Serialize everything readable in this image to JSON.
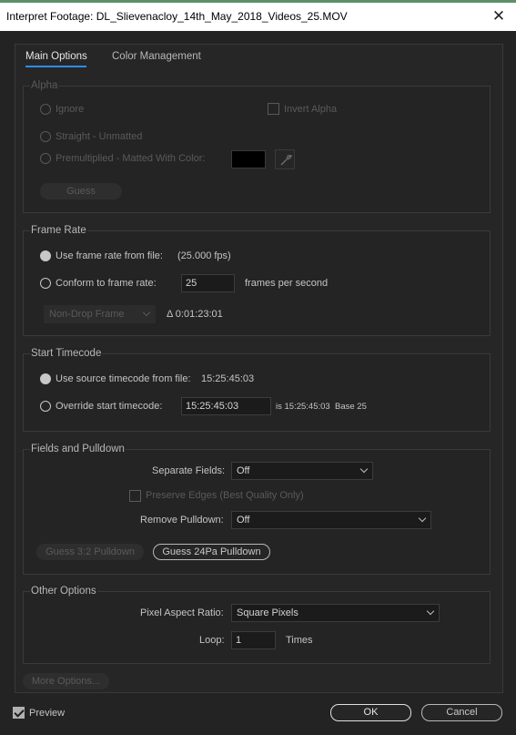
{
  "window": {
    "title": "Interpret Footage: DL_Slievenacloy_14th_May_2018_Videos_25.MOV",
    "close_glyph": "✕"
  },
  "tabs": [
    {
      "label": "Main Options",
      "active": true
    },
    {
      "label": "Color Management",
      "active": false
    }
  ],
  "alpha": {
    "title": "Alpha",
    "ignore": "Ignore",
    "invert": "Invert Alpha",
    "straight": "Straight - Unmatted",
    "premultiplied": "Premultiplied - Matted With Color:",
    "matte_color": "#000000",
    "guess": "Guess"
  },
  "frame_rate": {
    "title": "Frame Rate",
    "use_file": "Use frame rate from file:",
    "file_fps": "(25.000 fps)",
    "conform": "Conform to frame rate:",
    "conform_value": "25",
    "fps_unit": "frames per second",
    "drop_frame": "Non-Drop Frame",
    "duration": "Δ 0:01:23:01"
  },
  "start_timecode": {
    "title": "Start Timecode",
    "use_source": "Use source timecode from file:",
    "source_value": "15:25:45:03",
    "override": "Override start timecode:",
    "override_value": "15:25:45:03",
    "is_text": "is 15:25:45:03",
    "base_text": "Base 25"
  },
  "fields": {
    "title": "Fields and Pulldown",
    "separate_label": "Separate Fields:",
    "separate_value": "Off",
    "preserve": "Preserve Edges (Best Quality Only)",
    "remove_label": "Remove Pulldown:",
    "remove_value": "Off",
    "guess32": "Guess 3:2 Pulldown",
    "guess24": "Guess 24Pa Pulldown"
  },
  "other": {
    "title": "Other Options",
    "par_label": "Pixel Aspect Ratio:",
    "par_value": "Square Pixels",
    "loop_label": "Loop:",
    "loop_value": "1",
    "loop_unit": "Times"
  },
  "more_options": "More Options...",
  "footer": {
    "preview": "Preview",
    "ok": "OK",
    "cancel": "Cancel"
  }
}
